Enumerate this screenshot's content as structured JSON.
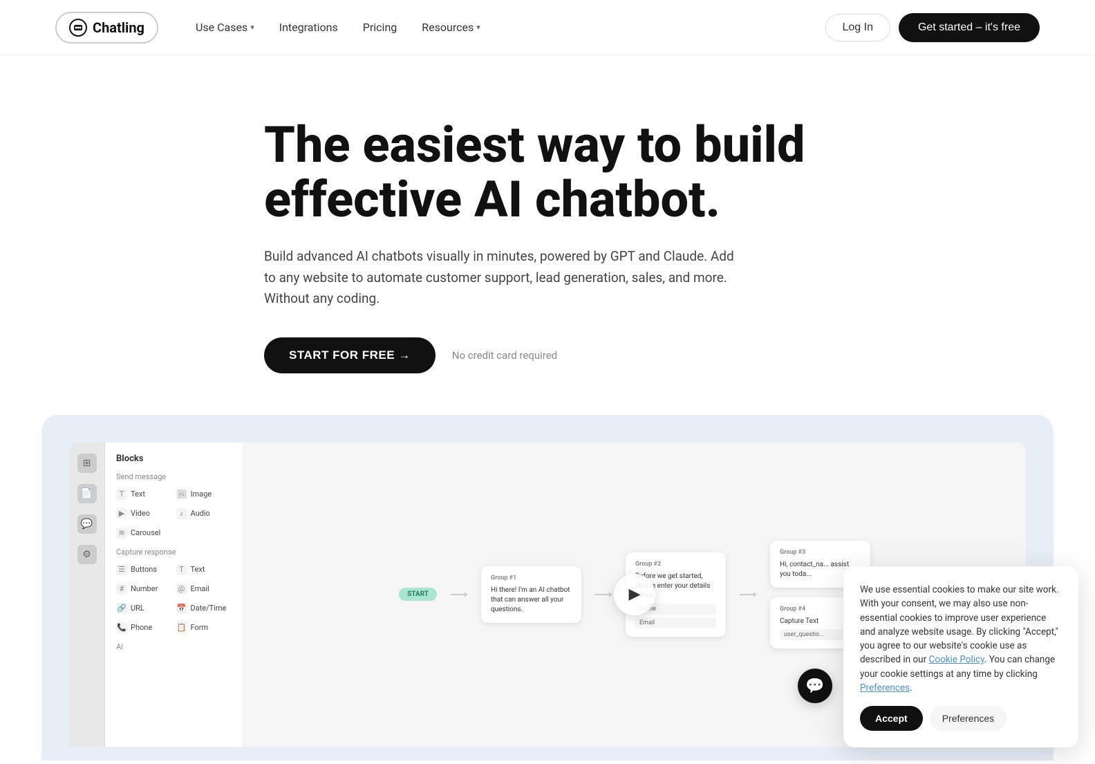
{
  "nav": {
    "logo_text": "Chatling",
    "links": [
      {
        "label": "Use Cases",
        "has_dropdown": true
      },
      {
        "label": "Integrations",
        "has_dropdown": false
      },
      {
        "label": "Pricing",
        "has_dropdown": false
      },
      {
        "label": "Resources",
        "has_dropdown": true
      }
    ],
    "login_label": "Log In",
    "cta_label": "Get started – it's free"
  },
  "hero": {
    "headline": "The easiest way to build effective AI chatbot.",
    "subtext": "Build advanced AI chatbots visually in minutes, powered by GPT and Claude. Add to any website to automate customer support, lead generation, sales, and more. Without any coding.",
    "cta_label": "START FOR FREE →",
    "no_cc_text": "No credit card required"
  },
  "demo": {
    "blocks_title": "Blocks",
    "send_message_title": "Send message",
    "block_items_send": [
      {
        "icon": "T",
        "label": "Text"
      },
      {
        "icon": "🖼",
        "label": "Image"
      },
      {
        "icon": "▶",
        "label": "Video"
      },
      {
        "icon": "🎵",
        "label": "Audio"
      },
      {
        "icon": "🎠",
        "label": "Carousel"
      }
    ],
    "capture_title": "Capture response",
    "block_items_capture": [
      {
        "icon": "☰",
        "label": "Buttons"
      },
      {
        "icon": "T",
        "label": "Text"
      },
      {
        "icon": "#",
        "label": "Number"
      },
      {
        "icon": "@",
        "label": "Email"
      },
      {
        "icon": "🔗",
        "label": "URL"
      },
      {
        "icon": "📅",
        "label": "Date/Time"
      },
      {
        "icon": "📞",
        "label": "Phone"
      },
      {
        "icon": "📋",
        "label": "Form"
      }
    ],
    "ai_label": "AI",
    "start_label": "START",
    "nodes": [
      {
        "id": "group1",
        "title": "Group #1",
        "content": "Hi there! I'm an AI chatbot that can answer all your questions."
      },
      {
        "id": "group2",
        "title": "Group #2",
        "content": "Before we get started, please enter your details below.",
        "fields": [
          "Name",
          "Email"
        ]
      },
      {
        "id": "group3",
        "title": "Group #3",
        "content": "Hi, contact_na... assist you toda..."
      },
      {
        "id": "group4",
        "title": "Group #4",
        "content": "Capture Text",
        "fields": [
          "user_questio..."
        ]
      }
    ]
  },
  "cookie": {
    "text": "We use essential cookies to make our site work. With your consent, we may also use non-essential cookies to improve user experience and analyze website usage. By clicking \"Accept,\" you agree to our website's cookie use as described in our ",
    "cookie_policy_label": "Cookie Policy",
    "middle_text": ". You can change your cookie settings at any time by clicking ",
    "preferences_label": "Preferences",
    "period": ".",
    "accept_label": "Accept",
    "prefs_label": "Preferences"
  }
}
